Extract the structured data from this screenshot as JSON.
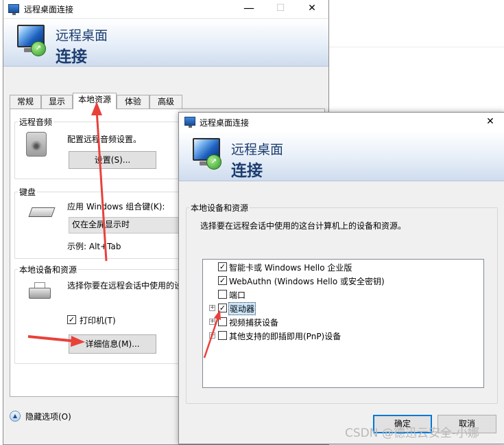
{
  "bg_window": {
    "title": "远程桌面连接",
    "banner_line1": "远程桌面",
    "banner_line2": "连接",
    "tabs": [
      "常规",
      "显示",
      "本地资源",
      "体验",
      "高级"
    ],
    "active_tab": "本地资源",
    "audio": {
      "group_label": "远程音频",
      "description": "配置远程音频设置。",
      "settings_button": "设置(S)..."
    },
    "keyboard": {
      "group_label": "键盘",
      "description": "应用 Windows 组合键(K):",
      "combo_value": "仅在全屏显示时",
      "example": "示例: Alt+Tab"
    },
    "devices": {
      "group_label": "本地设备和资源",
      "description": "选择你要在远程会话中使用的设",
      "printer_label": "打印机(T)",
      "printer_checked": true,
      "details_button": "详细信息(M)..."
    },
    "hide_options": "隐藏选项(O)"
  },
  "fg_dialog": {
    "title": "远程桌面连接",
    "close_glyph": "✕",
    "banner_line1": "远程桌面",
    "banner_line2": "连接",
    "group_label": "本地设备和资源",
    "description": "选择要在远程会话中使用的这台计算机上的设备和资源。",
    "items": [
      {
        "label": "智能卡或 Windows Hello 企业版",
        "checked": true,
        "expander": false
      },
      {
        "label": "WebAuthn (Windows Hello 或安全密钥)",
        "checked": true,
        "expander": false
      },
      {
        "label": "端口",
        "checked": false,
        "expander": false
      },
      {
        "label": "驱动器",
        "checked": true,
        "expander": true,
        "selected": true
      },
      {
        "label": "视频捕获设备",
        "checked": false,
        "expander": true
      },
      {
        "label": "其他支持的即插即用(PnP)设备",
        "checked": false,
        "expander": true
      }
    ],
    "ok_button": "确定",
    "cancel_button": "取消"
  },
  "watermark": "CSDN @德迅云安全-小娜",
  "colors": {
    "annotation_arrow": "#e8413a",
    "banner_text": "#1c3d70",
    "default_button_border": "#0078d7",
    "selection": "#cce8ff"
  },
  "icons": {
    "app": "remote-desktop-icon",
    "audio": "speaker-icon",
    "keyboard": "keyboard-icon",
    "devices": "printer-icon"
  }
}
